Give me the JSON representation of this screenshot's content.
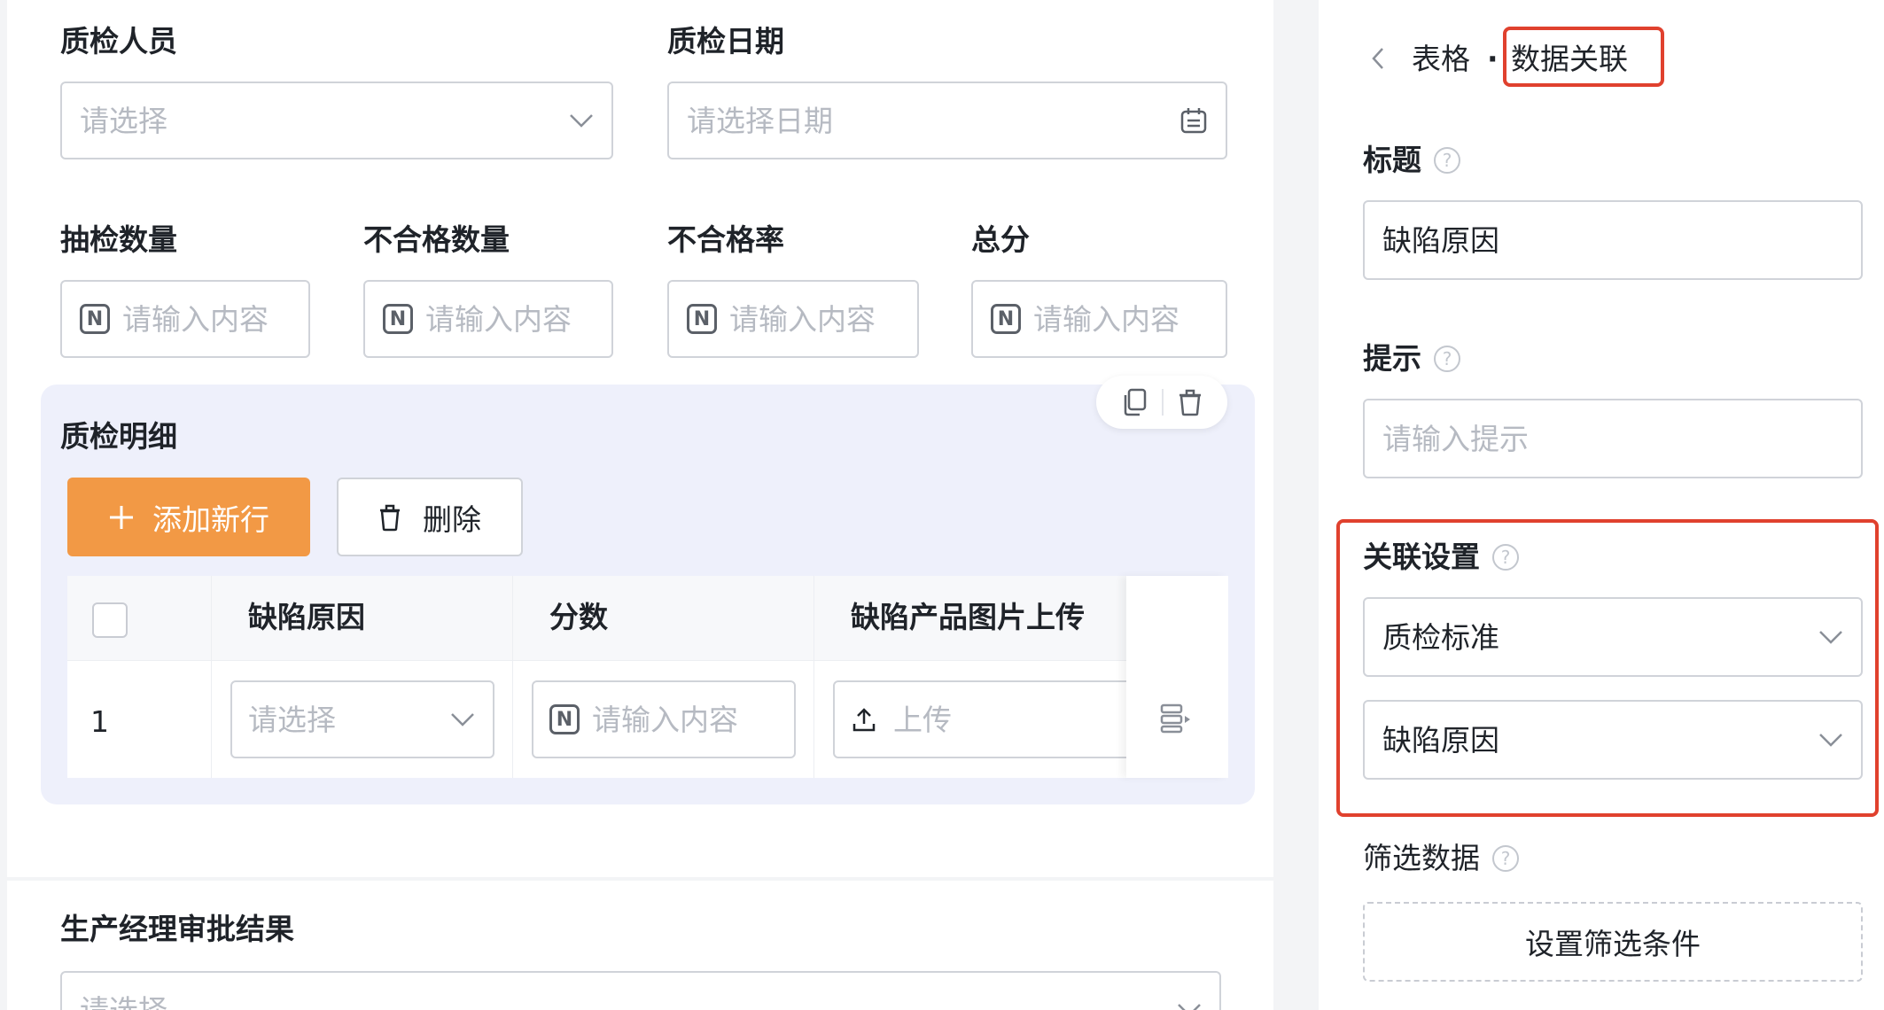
{
  "form": {
    "inspector": {
      "label": "质检人员",
      "placeholder": "请选择"
    },
    "inspect_date": {
      "label": "质检日期",
      "placeholder": "请选择日期"
    },
    "sample_qty": {
      "label": "抽检数量",
      "placeholder": "请输入内容"
    },
    "defect_qty": {
      "label": "不合格数量",
      "placeholder": "请输入内容"
    },
    "defect_rate": {
      "label": "不合格率",
      "placeholder": "请输入内容"
    },
    "total_score": {
      "label": "总分",
      "placeholder": "请输入内容"
    },
    "detail": {
      "label": "质检明细",
      "add_row_label": "添加新行",
      "delete_label": "删除",
      "columns": [
        "缺陷原因",
        "分数",
        "缺陷产品图片上传"
      ],
      "rows": [
        {
          "index": "1",
          "reason_placeholder": "请选择",
          "score_placeholder": "请输入内容",
          "upload_label": "上传"
        }
      ]
    },
    "approval": {
      "label": "生产经理审批结果",
      "placeholder": "请选择"
    }
  },
  "panel": {
    "breadcrumb_parent": "表格",
    "breadcrumb_sep": "·",
    "breadcrumb_current": "数据关联",
    "title_field": {
      "label": "标题",
      "value": "缺陷原因"
    },
    "hint_field": {
      "label": "提示",
      "placeholder": "请输入提示"
    },
    "link_settings": {
      "label": "关联设置",
      "form_value": "质检标准",
      "field_value": "缺陷原因"
    },
    "filter": {
      "label": "筛选数据",
      "button_label": "设置筛选条件"
    },
    "help_glyph": "?"
  },
  "colors": {
    "accent": "#f29945",
    "highlight": "#e0412e",
    "subtable_bg": "#eef0fb"
  },
  "icons": [
    "chevron-down-icon",
    "calendar-icon",
    "number-icon",
    "copy-icon",
    "trash-icon",
    "plus-icon",
    "upload-icon",
    "row-detail-icon",
    "back-icon",
    "help-icon"
  ]
}
